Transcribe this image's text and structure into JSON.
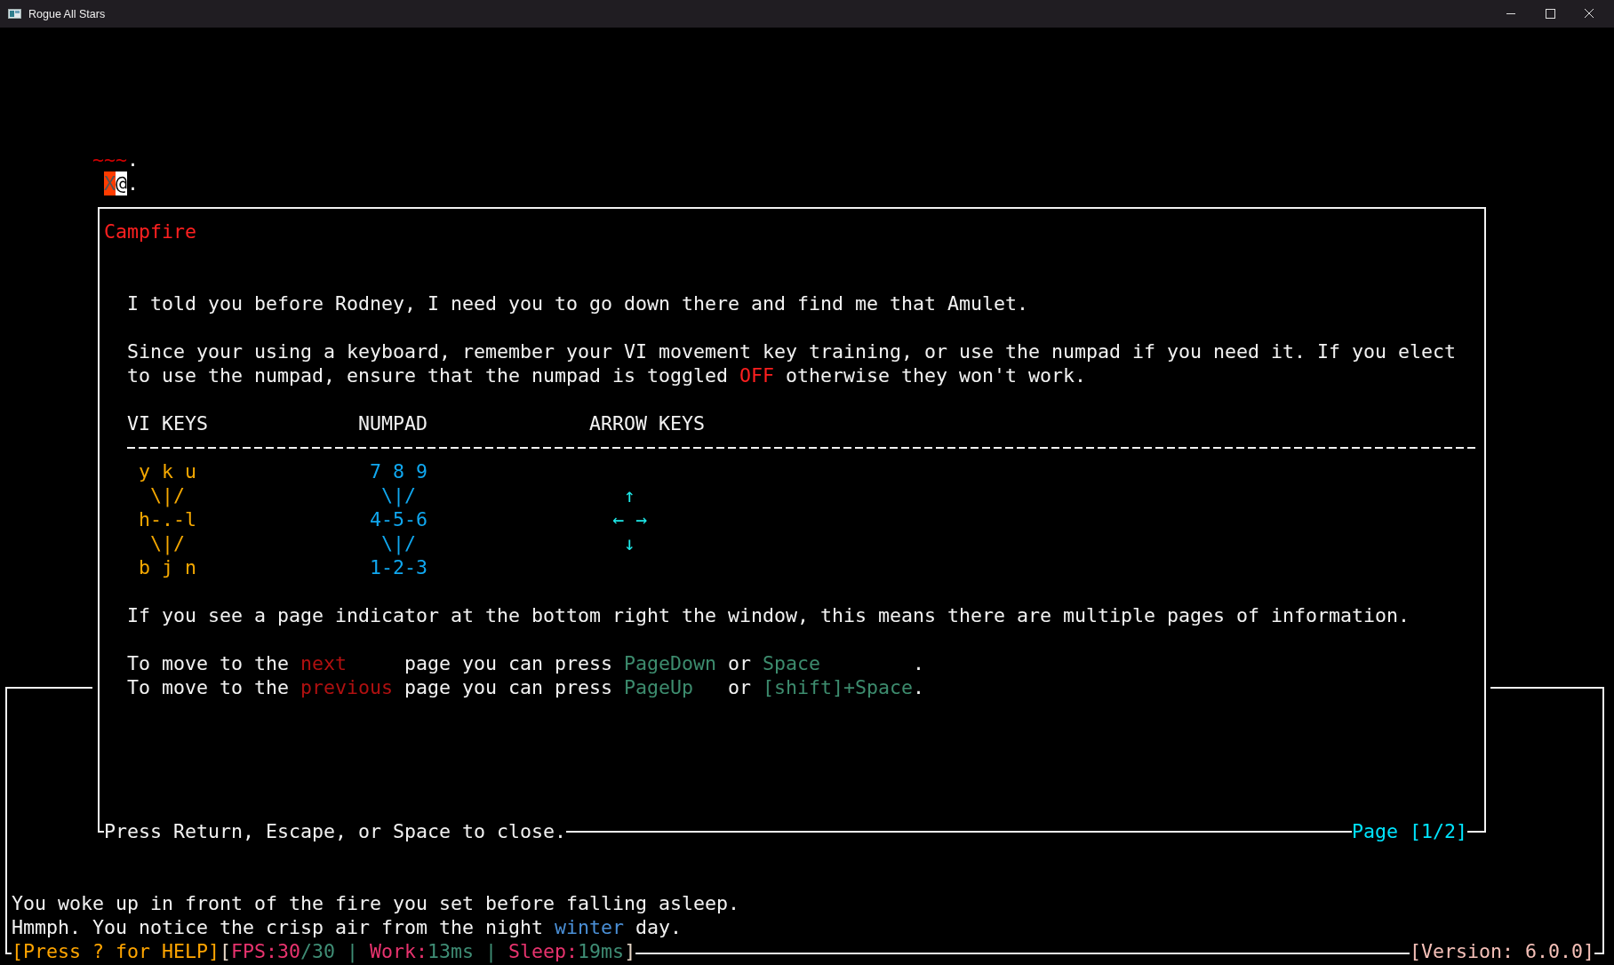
{
  "window": {
    "title": "Rogue All Stars"
  },
  "map": {
    "rows": [
      [
        {
          "kind": "water",
          "text": "~"
        },
        {
          "kind": "water",
          "text": "~"
        },
        {
          "kind": "water",
          "text": "~"
        },
        {
          "kind": "floor",
          "text": "."
        }
      ],
      [
        {
          "kind": "blank",
          "text": ""
        },
        {
          "kind": "monster",
          "text": "X"
        },
        {
          "kind": "player",
          "text": "@"
        },
        {
          "kind": "floor",
          "text": "."
        }
      ]
    ]
  },
  "dialog": {
    "title": "Campfire",
    "intro": "I told you before Rodney, I need you to go down there and find me that Amulet.",
    "advice": [
      {
        "kind": "plain",
        "text": "Since your using a keyboard, remember your VI movement key training, or use the numpad if you need it. If you elect to use the numpad, ensure that the numpad is toggled "
      },
      {
        "kind": "alert",
        "text": "OFF"
      },
      {
        "kind": "plain",
        "text": " otherwise they won't work."
      }
    ],
    "key_table": {
      "columns": [
        {
          "kind": "vi",
          "header": "VI KEYS",
          "lines": [
            "y k u",
            "\\|/",
            "h-.-l",
            "\\|/",
            "b j n"
          ]
        },
        {
          "kind": "numpad",
          "header": "NUMPAD",
          "lines": [
            "7 8 9",
            "\\|/",
            "4-5-6",
            "\\|/",
            "1-2-3"
          ]
        },
        {
          "kind": "arrows",
          "header": "ARROW KEYS",
          "lines": [
            "↑",
            "← →",
            "↓"
          ]
        }
      ]
    },
    "paging_note": "If you see a page indicator at the bottom right the window, this means there are multiple pages of information.",
    "instructions": [
      {
        "lead": "To move to the",
        "direction": "next",
        "middle": "page you can press",
        "key": "PageDown",
        "conj": "or",
        "alt_key": "Space",
        "end": "."
      },
      {
        "lead": "To move to the",
        "direction": "previous",
        "middle": "page you can press",
        "key": "PageUp",
        "conj": "or",
        "alt_key": "[shift]+Space",
        "end": "."
      }
    ],
    "footer": {
      "hint": "Press Return, Escape, or Space to close.",
      "page": "Page [1/2]"
    }
  },
  "messages": [
    [
      {
        "kind": "plain",
        "text": "You woke up in front of the fire you set before falling asleep."
      }
    ],
    [
      {
        "kind": "plain",
        "text": "Hmmph. You notice the crisp air from the night "
      },
      {
        "kind": "season",
        "text": "winter"
      },
      {
        "kind": "plain",
        "text": " day."
      }
    ]
  ],
  "status_bar": {
    "help": "[Press ? for HELP]",
    "stats": [
      {
        "kind": "bracket",
        "text": "["
      },
      {
        "kind": "label",
        "text": "FPS:30"
      },
      {
        "kind": "value",
        "text": "/30 | "
      },
      {
        "kind": "label",
        "text": "Work:"
      },
      {
        "kind": "value",
        "text": "13ms | "
      },
      {
        "kind": "label",
        "text": "Sleep:"
      },
      {
        "kind": "value",
        "text": "19ms"
      },
      {
        "kind": "bracket",
        "text": "]"
      }
    ],
    "version": "[Version: 6.0.0]"
  }
}
